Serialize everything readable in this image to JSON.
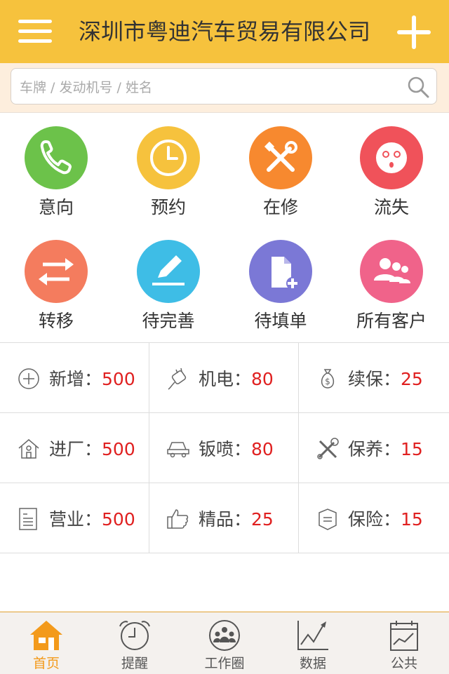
{
  "header": {
    "title": "深圳市粤迪汽车贸易有限公司",
    "menu_icon": "menu-icon",
    "add_icon": "plus-icon"
  },
  "search": {
    "placeholder": "车牌 / 发动机号 / 姓名",
    "value": "",
    "icon": "search-icon"
  },
  "categories": [
    {
      "label": "意向",
      "icon": "phone-icon",
      "color": "#6cc24a"
    },
    {
      "label": "预约",
      "icon": "clock-icon",
      "color": "#f6c23d"
    },
    {
      "label": "在修",
      "icon": "tools-icon",
      "color": "#f7892f"
    },
    {
      "label": "流失",
      "icon": "sad-face-icon",
      "color": "#f0525a"
    },
    {
      "label": "转移",
      "icon": "transfer-icon",
      "color": "#f47c5e"
    },
    {
      "label": "待完善",
      "icon": "pencil-icon",
      "color": "#3ebde6"
    },
    {
      "label": "待填单",
      "icon": "document-add-icon",
      "color": "#7b78d6"
    },
    {
      "label": "所有客户",
      "icon": "customers-icon",
      "color": "#f0638a"
    }
  ],
  "stats": [
    {
      "label": "新增",
      "value": "500",
      "icon": "plus-circle-icon"
    },
    {
      "label": "机电",
      "value": "80",
      "icon": "plug-icon"
    },
    {
      "label": "续保",
      "value": "25",
      "icon": "money-bag-icon"
    },
    {
      "label": "进厂",
      "value": "500",
      "icon": "house-icon"
    },
    {
      "label": "钣喷",
      "value": "80",
      "icon": "car-icon"
    },
    {
      "label": "保养",
      "value": "15",
      "icon": "wrench-icon"
    },
    {
      "label": "营业",
      "value": "500",
      "icon": "receipt-icon"
    },
    {
      "label": "精品",
      "value": "25",
      "icon": "thumbs-up-icon"
    },
    {
      "label": "保险",
      "value": "15",
      "icon": "insurance-icon"
    }
  ],
  "stat_separator": "：",
  "tabs": [
    {
      "label": "首页",
      "icon": "home-icon",
      "active": true
    },
    {
      "label": "提醒",
      "icon": "alarm-clock-icon",
      "active": false
    },
    {
      "label": "工作圈",
      "icon": "group-icon",
      "active": false
    },
    {
      "label": "数据",
      "icon": "chart-icon",
      "active": false
    },
    {
      "label": "公共",
      "icon": "calendar-icon",
      "active": false
    }
  ],
  "colors": {
    "accent": "#f6c23d",
    "active_tab": "#f39a1b",
    "number": "#e02020"
  }
}
